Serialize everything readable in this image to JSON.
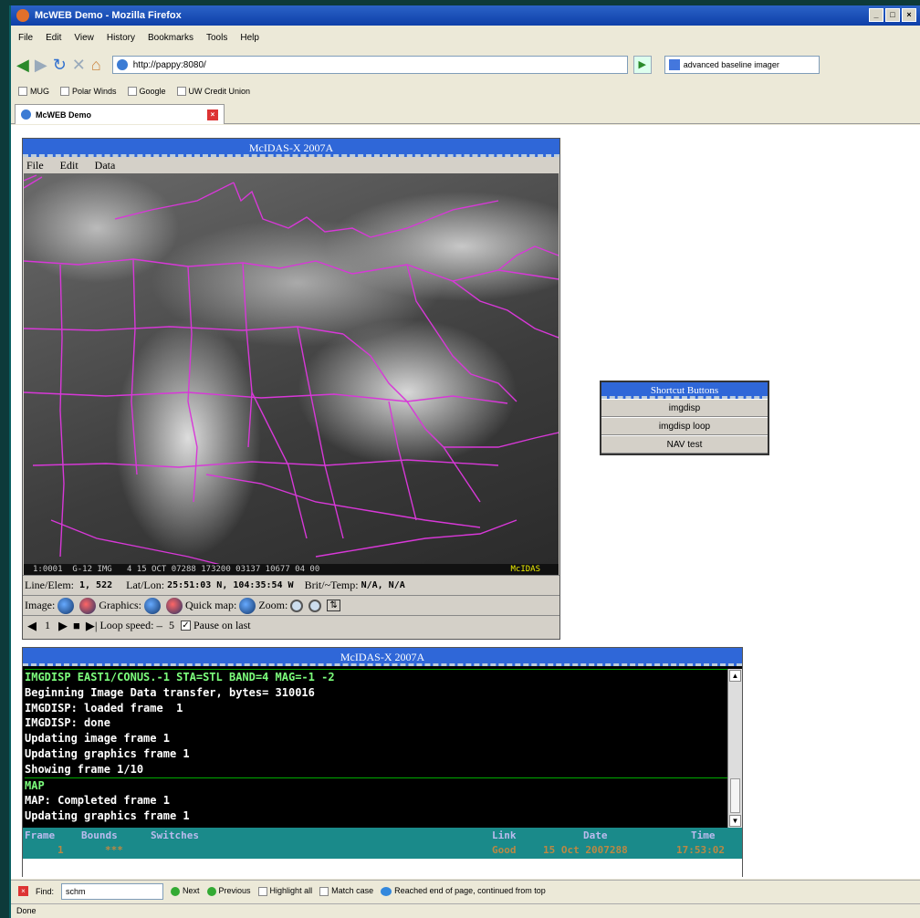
{
  "browser": {
    "window_title": "McWEB Demo - Mozilla Firefox",
    "window_controls": [
      "_",
      "□",
      "×"
    ],
    "menu": [
      "File",
      "Edit",
      "View",
      "History",
      "Bookmarks",
      "Tools",
      "Help"
    ],
    "url": "http://pappy:8080/",
    "search_text": "advanced baseline imager",
    "bookmarks": [
      "MUG",
      "Polar Winds",
      "Google",
      "UW Credit Union"
    ],
    "tab_title": "McWEB Demo",
    "find": {
      "label": "Find:",
      "value": "schm",
      "next": "Next",
      "previous": "Previous",
      "highlight_all": "Highlight all",
      "match_case": "Match case",
      "message": "Reached end of page, continued from top"
    },
    "status": "Done"
  },
  "mcidas_main": {
    "title": "McIDAS-X 2007A",
    "menu": [
      "File",
      "Edit",
      "Data"
    ],
    "image_status": "1:0001  G-12 IMG   4 15 OCT 07288 173200 03137 10677 04 00",
    "image_status_brand": "McIDAS",
    "line_elem_label": "Line/Elem:",
    "line_elem_value": "1, 522",
    "latlon_label": "Lat/Lon:",
    "latlon_value": "25:51:03 N, 104:35:54 W",
    "brit_label": "Brit/~Temp:",
    "brit_value": "N/A, N/A",
    "image_label": "Image:",
    "graphics_label": "Graphics:",
    "quickmap_label": "Quick map:",
    "zoom_label": "Zoom:",
    "frame_number": "1",
    "loop_speed_label": "Loop speed:",
    "loop_speed_value": "5",
    "pause_label": "Pause on last"
  },
  "shortcuts": {
    "title": "Shortcut Buttons",
    "buttons": [
      "imgdisp",
      "imgdisp loop",
      "NAV test"
    ]
  },
  "mcidas_terminal": {
    "title": "McIDAS-X 2007A",
    "lines": [
      {
        "text": "IMGDISP EAST1/CONUS.-1 STA=STL BAND=4 MAG=-1 -2",
        "green": true
      },
      {
        "text": "Beginning Image Data transfer, bytes= 310016",
        "green": false
      },
      {
        "text": "IMGDISP: loaded frame  1",
        "green": false
      },
      {
        "text": "IMGDISP: done",
        "green": false
      },
      {
        "text": "Updating image frame 1",
        "green": false
      },
      {
        "text": "Updating graphics frame 1",
        "green": false
      },
      {
        "text": "Showing frame 1/10",
        "green": false
      },
      {
        "text": "MAP",
        "green": true
      },
      {
        "text": "MAP: Completed frame 1",
        "green": false
      },
      {
        "text": "Updating graphics frame 1",
        "green": false
      }
    ],
    "status_headers": [
      "Frame",
      "Bounds",
      "Switches",
      "Link",
      "Date",
      "Time"
    ],
    "status_values": [
      "1",
      "***",
      "",
      "Good",
      "15 Oct 2007288",
      "17:53:02"
    ]
  },
  "colors": {
    "map_overlay": "#d838d8",
    "title_blue": "#2f67d8",
    "status_teal": "#1a8a8a"
  }
}
